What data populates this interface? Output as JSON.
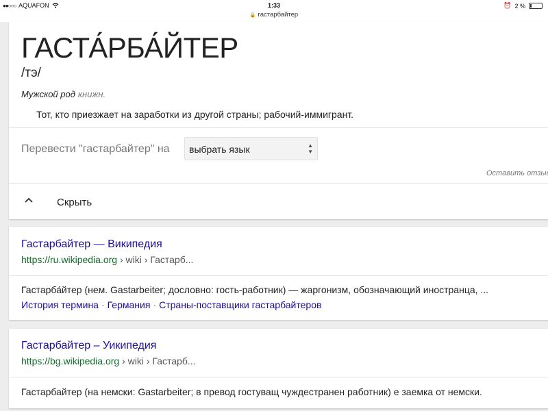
{
  "status_bar": {
    "carrier": "AQUAFON",
    "time": "1:33",
    "battery": "2 %",
    "url": "гастарбайтер"
  },
  "dictionary": {
    "word": "ГАСТА́РБА́ЙТЕР",
    "phonetic": "/тэ/",
    "part_of_speech": "Мужской род",
    "register": "книжн.",
    "definition": "Тот, кто приезжает на заработки из другой страны; рабочий-иммигрант.",
    "translate_label": "Перевести \"гастарбайтер\" на",
    "language_select_value": "выбрать язык",
    "feedback_link": "Оставить отзыв",
    "collapse_label": "Скрыть"
  },
  "results": [
    {
      "title": "Гастарбайтер — Википедия",
      "url_domain": "https://ru.wikipedia.org",
      "url_path": " › wiki › Гастарб...",
      "snippet": "Гастарба́йтер (нем. Gastarbeiter; дословно: гость-работник) — жаргонизм, обозначающий иностранца, ...",
      "links": [
        "История термина",
        "Германия",
        "Страны-поставщики гастарбайтеров"
      ]
    },
    {
      "title": "Гастарбайтер – Уикипедия",
      "url_domain": "https://bg.wikipedia.org",
      "url_path": " › wiki › Гастарб...",
      "snippet": "Гастарбайтер (на немски: Gastarbeiter; в превод гостуващ чуждестранен работник) е заемка от немски."
    }
  ],
  "colors": {
    "link": "#1a0dab",
    "url_green": "#0e6e27",
    "background": "#ededed"
  }
}
